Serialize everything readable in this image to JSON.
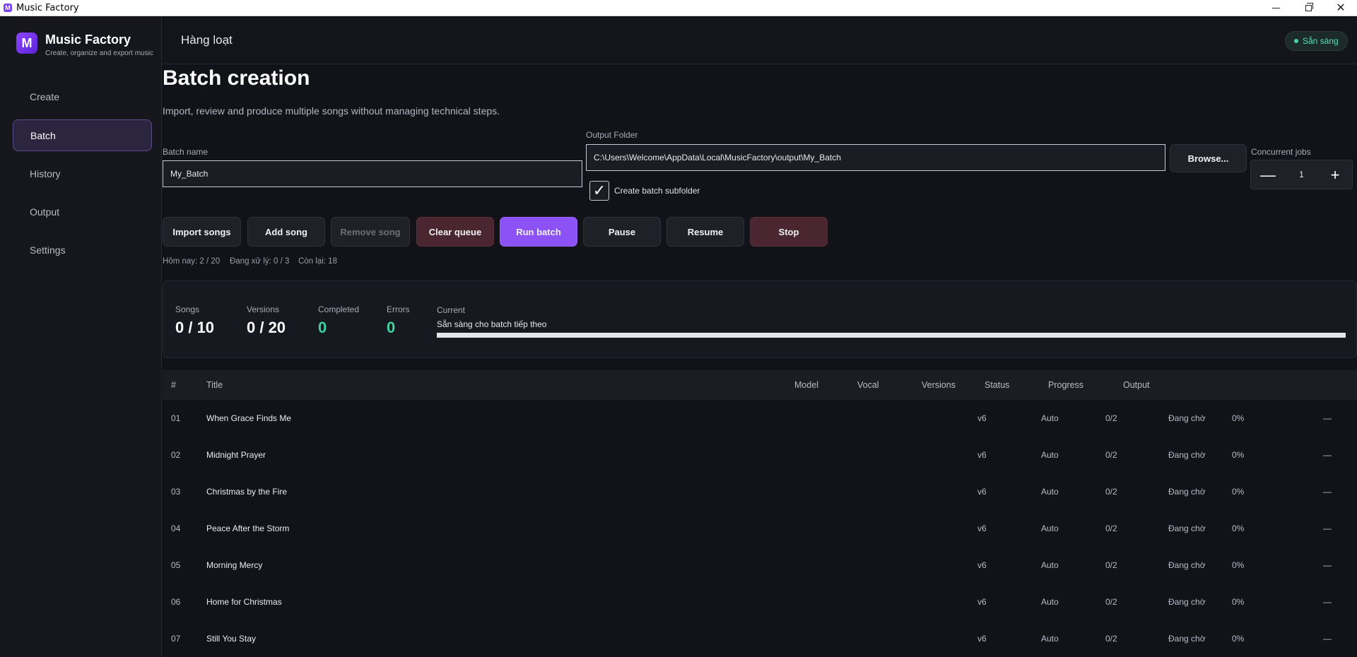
{
  "window": {
    "title": "Music Factory",
    "icon_letter": "M"
  },
  "brand": {
    "logo": "M",
    "name": "Music Factory",
    "subtitle": "Create, organize and export music"
  },
  "nav": [
    {
      "label": "Create"
    },
    {
      "label": "Batch"
    },
    {
      "label": "History"
    },
    {
      "label": "Output"
    },
    {
      "label": "Settings"
    }
  ],
  "header": {
    "title": "Hàng loạt",
    "status": "Sẵn sàng"
  },
  "page": {
    "title": "Batch creation",
    "subtitle": "Import, review and produce multiple songs without managing technical steps."
  },
  "form": {
    "batch_name_label": "Batch name",
    "batch_name_value": "My_Batch",
    "output_folder_label": "Output Folder",
    "output_folder_value": "C:\\Users\\Welcome\\AppData\\Local\\MusicFactory\\output\\My_Batch",
    "browse_label": "Browse...",
    "subfolder_label": "Create batch subfolder",
    "subfolder_checked": "✓",
    "concurrent_label": "Concurrent jobs",
    "concurrent_value": "1",
    "minus": "—",
    "plus": "+"
  },
  "actions": {
    "import": "Import songs",
    "add": "Add song",
    "remove": "Remove song",
    "clear": "Clear queue",
    "run": "Run batch",
    "pause": "Pause",
    "resume": "Resume",
    "stop": "Stop"
  },
  "counters": {
    "today": "Hôm nay: 2 / 20",
    "processing": "Đang xử lý: 0 / 3",
    "remaining": "Còn lại: 18"
  },
  "stats": {
    "songs_label": "Songs",
    "songs_value": "0 / 10",
    "versions_label": "Versions",
    "versions_value": "0 / 20",
    "completed_label": "Completed",
    "completed_value": "0",
    "errors_label": "Errors",
    "errors_value": "0",
    "current_label": "Current",
    "current_text": "Sẵn sàng cho batch tiếp theo",
    "progress_fraction": 1.0
  },
  "table": {
    "headers": [
      "#",
      "Title",
      "Model",
      "Vocal",
      "Versions",
      "Status",
      "Progress",
      "Output"
    ],
    "rows": [
      {
        "num": "01",
        "title": "When Grace Finds Me",
        "model": "v6",
        "vocal": "Auto",
        "versions": "0/2",
        "status": "Đang chờ",
        "progress": "0%",
        "output": "—"
      },
      {
        "num": "02",
        "title": "Midnight Prayer",
        "model": "v6",
        "vocal": "Auto",
        "versions": "0/2",
        "status": "Đang chờ",
        "progress": "0%",
        "output": "—"
      },
      {
        "num": "03",
        "title": "Christmas by the Fire",
        "model": "v6",
        "vocal": "Auto",
        "versions": "0/2",
        "status": "Đang chờ",
        "progress": "0%",
        "output": "—"
      },
      {
        "num": "04",
        "title": "Peace After the Storm",
        "model": "v6",
        "vocal": "Auto",
        "versions": "0/2",
        "status": "Đang chờ",
        "progress": "0%",
        "output": "—"
      },
      {
        "num": "05",
        "title": "Morning Mercy",
        "model": "v6",
        "vocal": "Auto",
        "versions": "0/2",
        "status": "Đang chờ",
        "progress": "0%",
        "output": "—"
      },
      {
        "num": "06",
        "title": "Home for Christmas",
        "model": "v6",
        "vocal": "Auto",
        "versions": "0/2",
        "status": "Đang chờ",
        "progress": "0%",
        "output": "—"
      },
      {
        "num": "07",
        "title": "Still You Stay",
        "model": "v6",
        "vocal": "Auto",
        "versions": "0/2",
        "status": "Đang chờ",
        "progress": "0%",
        "output": "—"
      }
    ]
  }
}
